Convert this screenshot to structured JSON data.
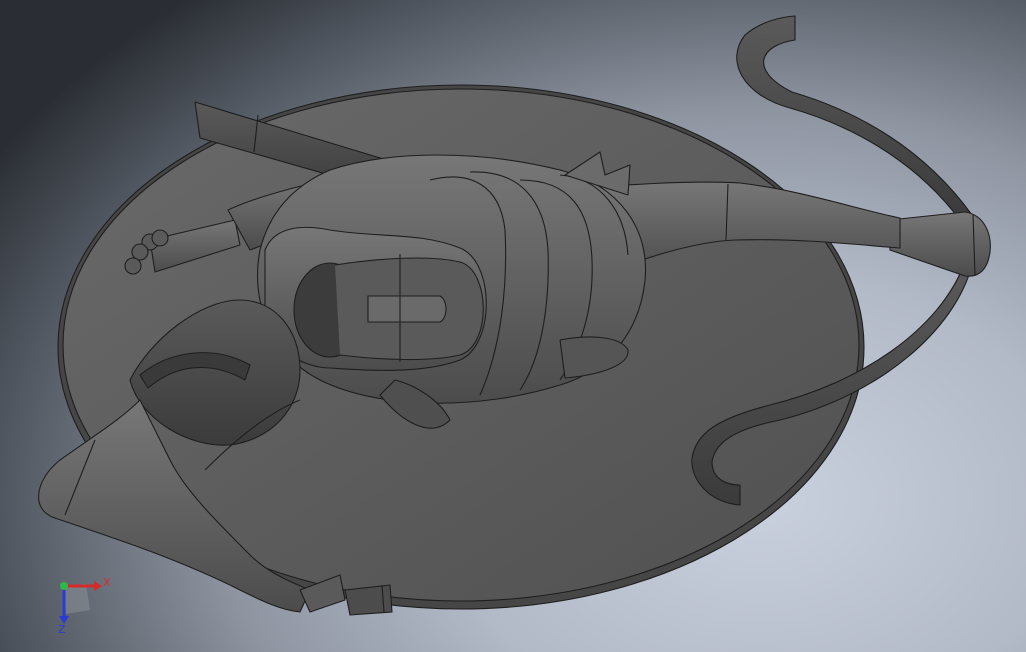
{
  "viewport": {
    "background_colors": {
      "center": "#c9d0de",
      "edge": "#2a2e34"
    }
  },
  "model": {
    "shade_color": "#5f5f5f",
    "edge_color": "#1e1e1e"
  },
  "triad": {
    "x_label": "X",
    "z_label": "Z",
    "x_color": "#d42a2a",
    "y_color": "#2fb84a",
    "z_color": "#2a3bd4"
  }
}
